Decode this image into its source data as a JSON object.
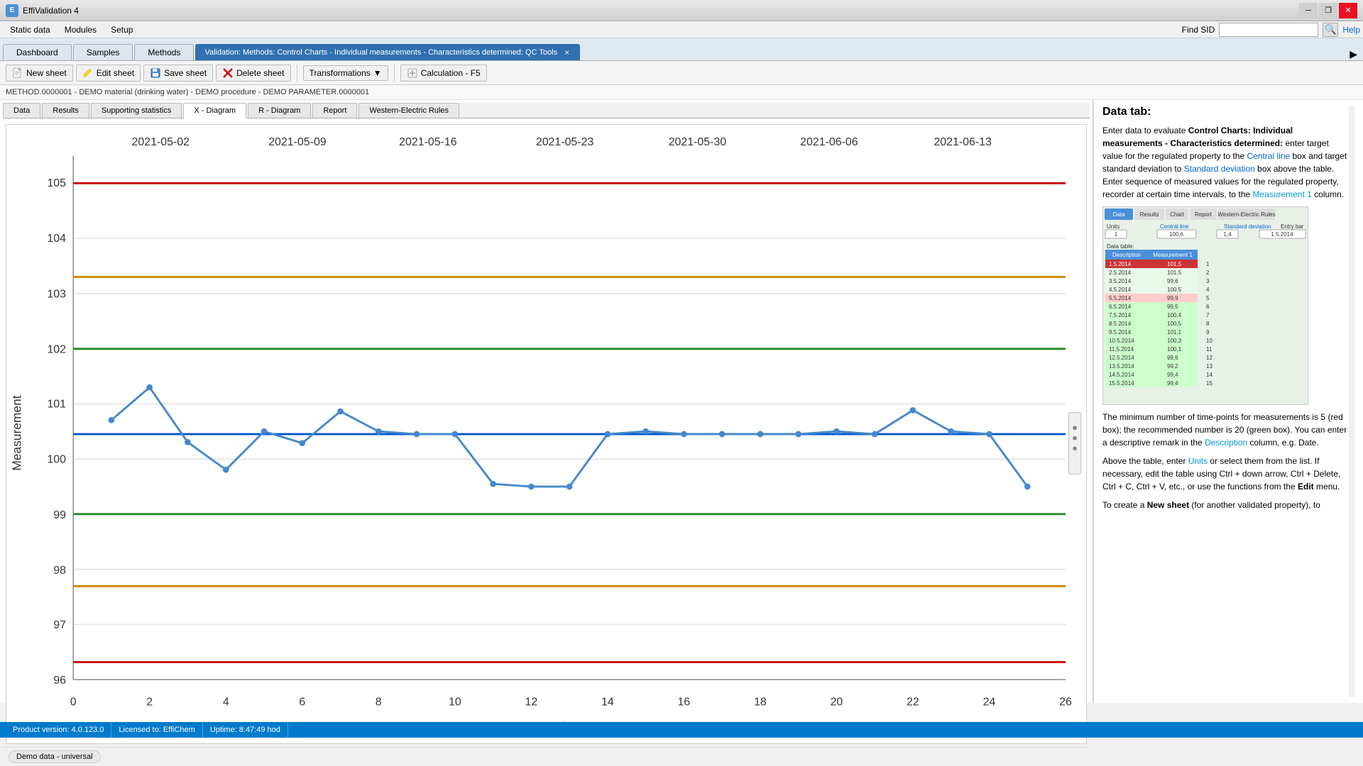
{
  "app": {
    "title": "EffiValidation 4",
    "icon": "E"
  },
  "titlebar": {
    "minimize": "─",
    "restore": "❐",
    "close": "✕"
  },
  "menubar": {
    "items": [
      "Static data",
      "Modules",
      "Setup"
    ],
    "find_sid_label": "Find SID",
    "find_sid_placeholder": "",
    "help_label": "Help"
  },
  "nav_tabs": [
    {
      "label": "Dashboard",
      "active": false
    },
    {
      "label": "Samples",
      "active": false
    },
    {
      "label": "Methods",
      "active": false
    }
  ],
  "main_tab": {
    "label": "Validation: Methods: Control Charts - Individual measurements - Characteristics determined: QC Tools",
    "close": "×"
  },
  "toolbar": {
    "new_sheet": "New sheet",
    "edit_sheet": "Edit sheet",
    "save_sheet": "Save sheet",
    "delete_sheet": "Delete sheet",
    "transformations": "Transformations",
    "calculation": "Calculation - F5"
  },
  "breadcrumb": "METHOD.0000001 - DEMO material (drinking water) - DEMO procedure - DEMO PARAMETER.0000001",
  "inner_tabs": [
    "Data",
    "Results",
    "Supporting statistics",
    "X - Diagram",
    "R - Diagram",
    "Report",
    "Western-Electric Rules"
  ],
  "active_inner_tab": "X - Diagram",
  "chart": {
    "x_label": "Time",
    "y_label": "Measurement",
    "x_min": 0,
    "x_max": 26,
    "y_min": 96,
    "y_max": 105.5,
    "x_ticks": [
      0,
      2,
      4,
      6,
      8,
      10,
      12,
      14,
      16,
      18,
      20,
      22,
      24,
      26
    ],
    "y_ticks": [
      96,
      97,
      98,
      99,
      100,
      101,
      102,
      103,
      104,
      105
    ],
    "date_labels": [
      "2021-05-02",
      "2021-05-09",
      "2021-05-16",
      "2021-05-23",
      "2021-05-30",
      "2021-06-06",
      "2021-06-13"
    ],
    "lines": {
      "upper_red": 105.0,
      "upper_yellow": 103.3,
      "upper_green": 102.0,
      "center_blue": 100.45,
      "lower_green": 99.0,
      "lower_yellow": 97.7,
      "lower_red": 96.3
    },
    "data_points": [
      {
        "x": 1,
        "y": 100.7
      },
      {
        "x": 2,
        "y": 101.3
      },
      {
        "x": 3,
        "y": 100.3
      },
      {
        "x": 4,
        "y": 99.8
      },
      {
        "x": 5,
        "y": 100.5
      },
      {
        "x": 6,
        "y": 100.1
      },
      {
        "x": 7,
        "y": 100.4
      },
      {
        "x": 8,
        "y": 100.35
      },
      {
        "x": 9,
        "y": 100.45
      },
      {
        "x": 10,
        "y": 100.45
      },
      {
        "x": 11,
        "y": 99.55
      },
      {
        "x": 12,
        "y": 99.5
      },
      {
        "x": 13,
        "y": 99.5
      },
      {
        "x": 14,
        "y": 100.45
      },
      {
        "x": 15,
        "y": 100.5
      },
      {
        "x": 16,
        "y": 100.45
      },
      {
        "x": 17,
        "y": 100.45
      },
      {
        "x": 18,
        "y": 100.45
      },
      {
        "x": 19,
        "y": 100.45
      },
      {
        "x": 20,
        "y": 100.5
      },
      {
        "x": 21,
        "y": 100.45
      },
      {
        "x": 22,
        "y": 100.9
      },
      {
        "x": 23,
        "y": 100.5
      },
      {
        "x": 24,
        "y": 100.45
      },
      {
        "x": 25,
        "y": 99.5
      }
    ]
  },
  "instructions": {
    "title": "Data tab:",
    "text1": "Enter data to evaluate ",
    "bold1": "Control Charts: Individual measurements - Characteristics determined:",
    "text2": " enter target value for the regulated property to the ",
    "link1": "Central line",
    "text3": " box and target standard deviation to ",
    "link2": "Standard deviation",
    "text4": " box above the table. Enter sequence of measured values for the regulated property, recorder at certain time intervals, to the ",
    "link3": "Measurement 1",
    "text5": " column.",
    "text6": "The minimum number of time-points for measurements is 5 (red box); the recommended number is 20 (green box). You can enter a descriptive remark in the ",
    "link4": "Description",
    "text7": " column, e.g. Date.",
    "text8": "Above the table, enter ",
    "link5": "Units",
    "text9": " or select them from the list. If necessary, edit the table using Ctrl + down arrow, Ctrl + Delete, Ctrl + C, Ctrl + V, etc., or use the functions from the ",
    "bold2": "Edit",
    "text10": " menu.",
    "text11": "To create a ",
    "bold3": "New sheet",
    "text12": " (for another validated property), to"
  },
  "bottom_label": "Demo data - universal",
  "statusbar": {
    "version": "Product version: 4.0.123.0",
    "license": "Licensed to: EffiChem",
    "uptime": "Uptime: 8:47:49 hod"
  }
}
